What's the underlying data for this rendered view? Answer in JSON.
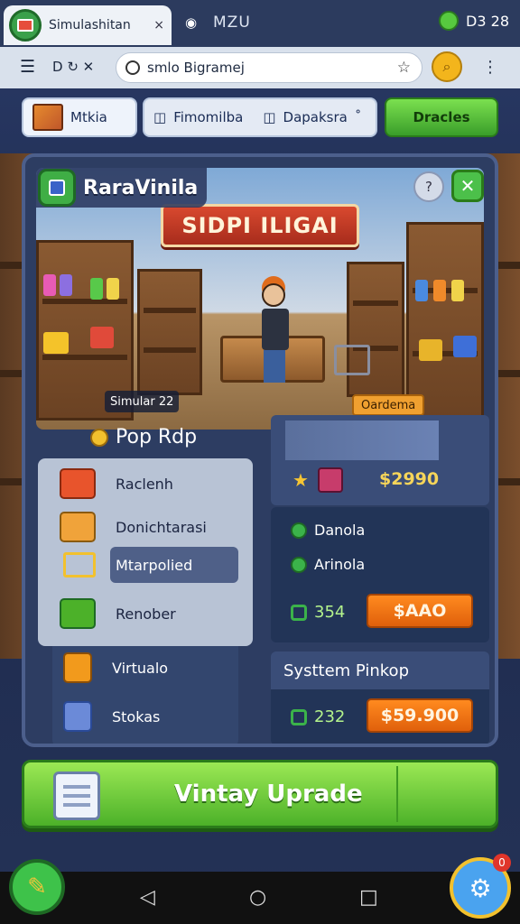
{
  "statusbar": {
    "tab_title": "Simulashitan",
    "tab_close": "×",
    "tab_number": "MZU",
    "clock": "D3 28"
  },
  "urlbar": {
    "menu_icon": "☰",
    "nav_text": "D ↻ ✕",
    "url": "smlo Bigramej",
    "star_icon": "☆",
    "search_icon": "⌕",
    "more_icon": "⋮"
  },
  "chips": {
    "shop": "Mtkia",
    "camera": "Fimomilba",
    "dispatch": "Dapaksra",
    "dispatch_suffix": "˚",
    "deals": "Dracles"
  },
  "scene": {
    "title": "RaraVinila",
    "banner": "SIDPI ILIGAI",
    "sim_badge": "Simular 22",
    "order_badge": "Oardema",
    "help_icon": "?",
    "close_icon": "✕"
  },
  "menu": {
    "header": "Pop Rdp",
    "items": [
      {
        "label": "Raclenh"
      },
      {
        "label": "Donichtarasi"
      },
      {
        "label": "Mtarpolied"
      },
      {
        "label": "Renober"
      },
      {
        "label": "Virtualo"
      },
      {
        "label": "Stokas"
      }
    ]
  },
  "offers": {
    "featured_price": "$2990",
    "check_1": "Danola",
    "check_2": "Arinola",
    "amount_1": "354",
    "buy_1": "$AAO",
    "system_title": "Systtem Pinkop",
    "amount_2": "232",
    "buy_2": "$59.900"
  },
  "cta": {
    "label": "Vintay Uprade"
  },
  "nav": {
    "back": "◁",
    "home": "○",
    "recent": "□",
    "badge": "0"
  },
  "colors": {
    "accent_green": "#4cb129",
    "accent_orange": "#e0600b",
    "panel": "#2d3d62"
  }
}
